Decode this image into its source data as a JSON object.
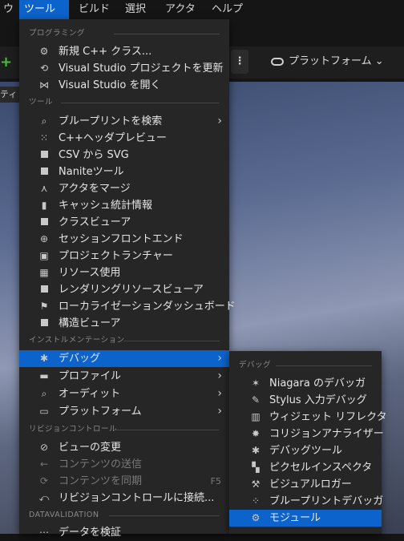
{
  "menubar": [
    "ウ",
    "ツール",
    "ビルド",
    "選択",
    "アクタ",
    "ヘルプ"
  ],
  "toolbar": {
    "platform_label": "プラットフォーム",
    "tab_label": "ティ"
  },
  "main_menu": {
    "sections": {
      "programming": "プログラミング",
      "tools": "ツール",
      "instrumentation": "インストルメンテーション",
      "revision": "リビジョンコントロール",
      "datavalidation": "DATAVALIDATION"
    },
    "items": {
      "new_cpp": "新規 C++ クラス...",
      "refresh_vs": "Visual Studio プロジェクトを更新",
      "open_vs": "Visual Studio を開く",
      "find_bp": "ブループリントを検索",
      "cpp_header": "C++ヘッダプレビュー",
      "csv_svg": "CSV から SVG",
      "nanite": "Naniteツール",
      "merge_actors": "アクタをマージ",
      "cache_stats": "キャッシュ統計情報",
      "class_viewer": "クラスビューア",
      "session_frontend": "セッションフロントエンド",
      "project_launcher": "プロジェクトランチャー",
      "resource_usage": "リソース使用",
      "render_resource": "レンダリングリソースビューア",
      "loc_dashboard": "ローカライゼーションダッシュボード",
      "struct_viewer": "構造ビューア",
      "debug": "デバッグ",
      "profile": "プロファイル",
      "audit": "オーディット",
      "platform": "プラットフォーム",
      "view_changes": "ビューの変更",
      "submit": "コンテンツの送信",
      "sync": "コンテンツを同期",
      "sync_shortcut": "F5",
      "connect_rc": "リビジョンコントロールに接続...",
      "validate": "データを検証"
    }
  },
  "sub_menu": {
    "section": "デバッグ",
    "items": [
      "Niagara のデバッガ",
      "Stylus 入力デバッグ",
      "ウィジェット リフレクタ",
      "コリジョンアナライザー",
      "デバッグツール",
      "ピクセルインスペクタ",
      "ビジュアルロガー",
      "ブループリントデバッガ",
      "モジュール"
    ]
  },
  "colors": {
    "highlight": "#0d63cc",
    "menu_bg": "#262626",
    "accent_green": "#4cbb3c"
  }
}
